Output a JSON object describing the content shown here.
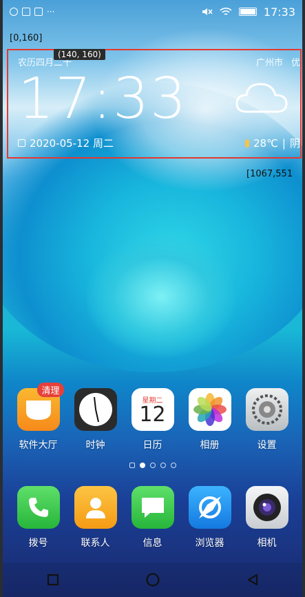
{
  "status_bar": {
    "time": "17:33",
    "left_icons": [
      "globe-icon",
      "sim-icon",
      "sim2-icon",
      "more-icon"
    ],
    "right_icons": [
      "mute-icon",
      "wifi-icon",
      "battery-icon"
    ]
  },
  "annotations": {
    "top_left_coord": "[0,160]",
    "tag_coord": "(140, 160)",
    "right_coord": "[1067,551",
    "box_color": "#e8362e"
  },
  "widget": {
    "lunar_date": "农历四月二十",
    "city": "广州市",
    "air_quality": "优",
    "time": "17:33",
    "date": "2020-05-12 周二",
    "temperature": "28℃",
    "weather": "阴",
    "weather_icon": "cloud-icon"
  },
  "apps_row1": [
    {
      "name": "app-store",
      "label": "软件大厅",
      "badge": "清理",
      "color": "#f7a21b",
      "icon": "bag-icon"
    },
    {
      "name": "clock",
      "label": "时钟",
      "color": "#2b2b2b",
      "icon": "clock-icon"
    },
    {
      "name": "calendar",
      "label": "日历",
      "color": "#ffffff",
      "icon": "calendar-icon",
      "weekday": "星期二",
      "day": "12"
    },
    {
      "name": "gallery",
      "label": "相册",
      "color": "#ffffff",
      "icon": "flower-icon"
    },
    {
      "name": "settings",
      "label": "设置",
      "color": "#d7dadc",
      "icon": "gear-icon"
    }
  ],
  "page_dots": {
    "count": 4,
    "active": 0
  },
  "apps_row2": [
    {
      "name": "phone",
      "label": "拨号",
      "color": "#3ccf4e",
      "icon": "phone-icon"
    },
    {
      "name": "contacts",
      "label": "联系人",
      "color": "#f7a81b",
      "icon": "person-icon"
    },
    {
      "name": "messages",
      "label": "信息",
      "color": "#3ccf4e",
      "icon": "chat-icon"
    },
    {
      "name": "browser",
      "label": "浏览器",
      "color": "#1e9af0",
      "icon": "compass-icon"
    },
    {
      "name": "camera",
      "label": "相机",
      "color": "#e9ecef",
      "icon": "camera-icon"
    }
  ],
  "nav_bar": [
    "recents-square-icon",
    "home-circle-icon",
    "back-triangle-icon"
  ]
}
